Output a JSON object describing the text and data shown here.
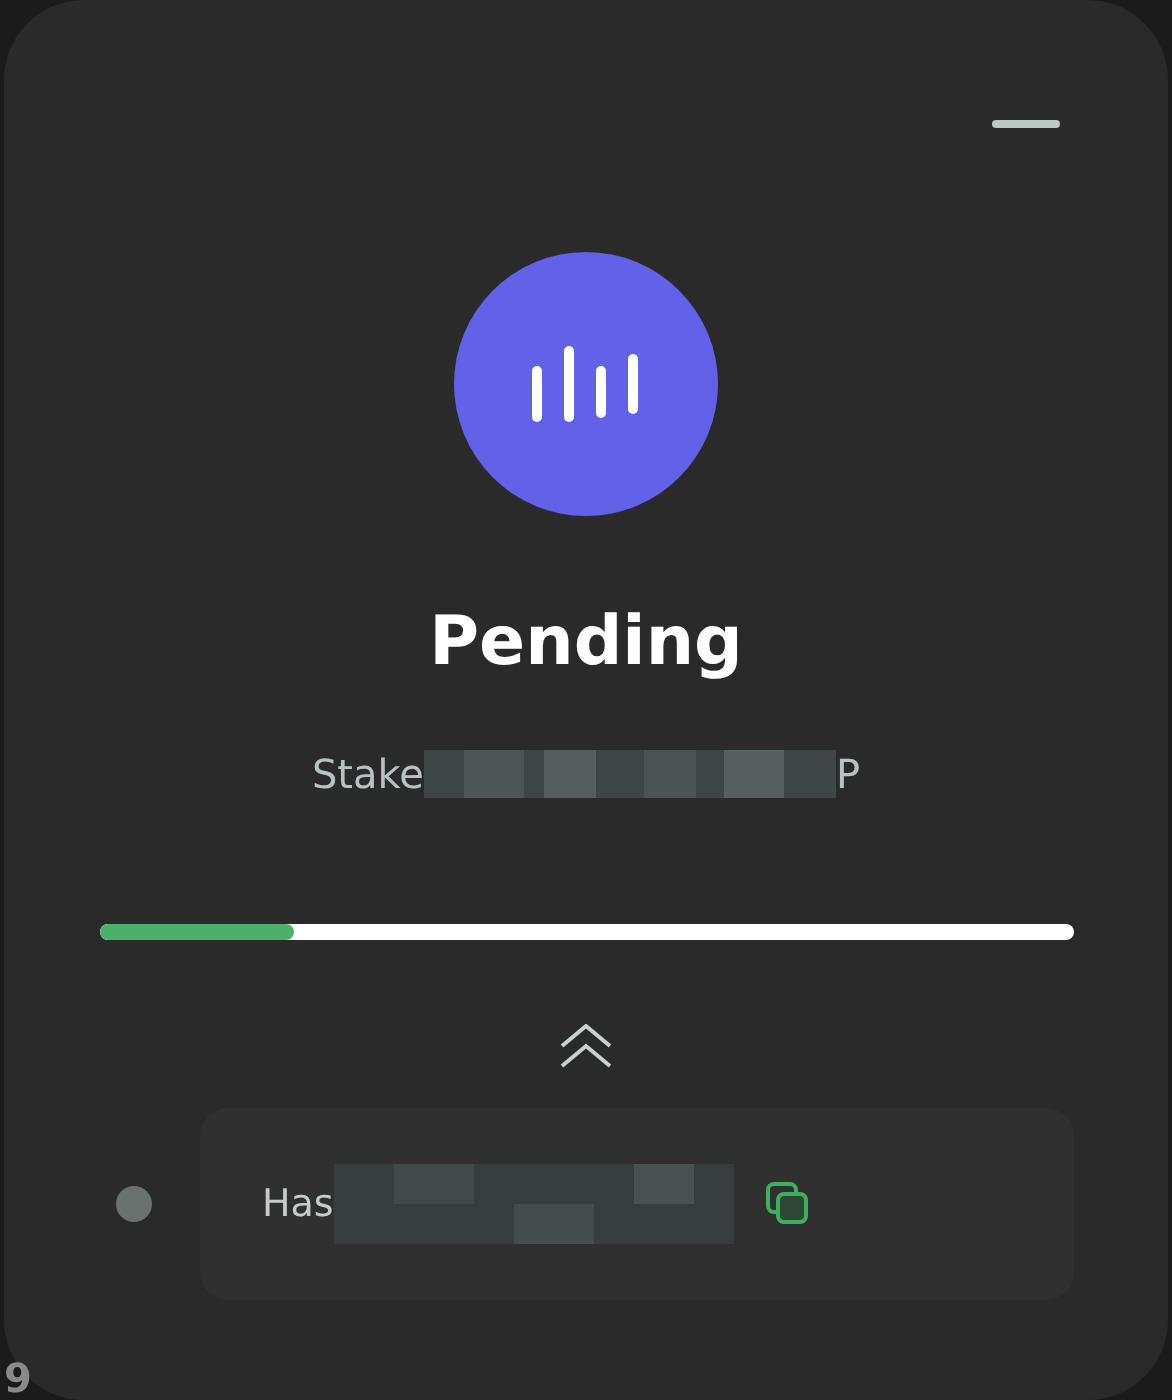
{
  "status": {
    "title": "Pending",
    "detail_start": "Stake",
    "detail_end": "P",
    "level": 0.2
  },
  "transaction": {
    "label": "Has"
  },
  "background_text": "9"
}
